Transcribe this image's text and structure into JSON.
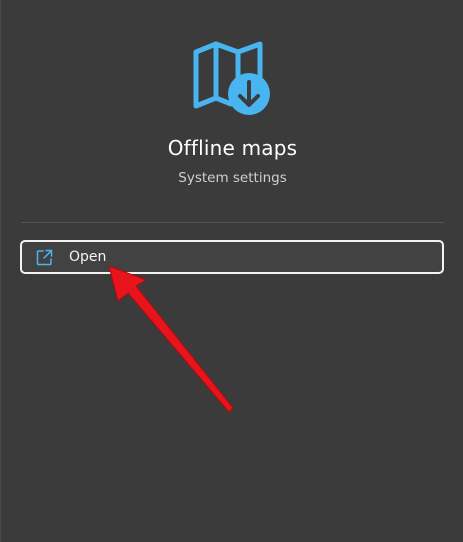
{
  "app": {
    "title": "Offline maps",
    "subtitle": "System settings",
    "icon": "offline-map-download-icon",
    "accent_color": "#48b4f0"
  },
  "actions": [
    {
      "label": "Open",
      "icon": "open-external-icon"
    }
  ],
  "annotation": {
    "icon": "red-arrow-pointer",
    "color": "#e8141c"
  }
}
